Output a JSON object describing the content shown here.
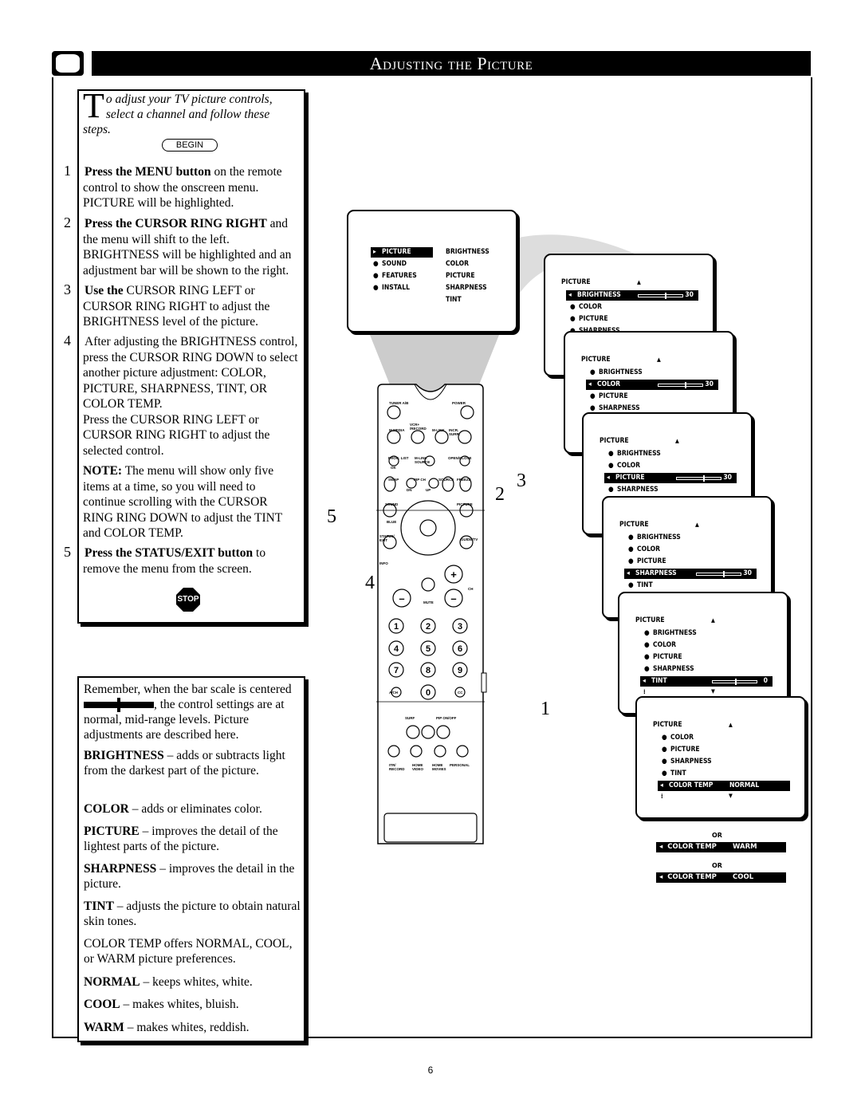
{
  "header": {
    "title": "Adjusting the Picture"
  },
  "intro": {
    "dropcap": "T",
    "text": "o adjust your TV picture controls, select a channel and follow these steps.",
    "begin": "BEGIN"
  },
  "steps": [
    {
      "num": "1",
      "bold": "Press the MENU button",
      "rest": " on the remote control to show the onscreen menu. PICTURE will be highlighted."
    },
    {
      "num": "2",
      "bold": "Press the CURSOR RING RIGHT",
      "rest": " and the menu will shift to the left. BRIGHTNESS will be highlighted and an adjustment bar will be shown to the right."
    },
    {
      "num": "3",
      "bold": "Use the",
      "rest": " CURSOR RING LEFT or CURSOR RING RIGHT to adjust the BRIGHTNESS level of the picture."
    },
    {
      "num": "4",
      "bold": "",
      "rest": "After adjusting the BRIGHTNESS control, press the CURSOR RING DOWN to select another picture adjustment: COLOR, PICTURE, SHARPNESS, TINT, OR COLOR TEMP.",
      "extra": "Press the CURSOR RING LEFT or CURSOR RING RIGHT to adjust the selected control.",
      "note_bold": "NOTE:",
      "note": " The menu will show only five items at a time, so you will need to continue scrolling with the CURSOR RING RING DOWN to adjust the TINT and COLOR TEMP."
    },
    {
      "num": "5",
      "bold": "Press the STATUS/EXIT button",
      "rest": " to remove the menu from the screen."
    }
  ],
  "stop": "STOP",
  "info": {
    "remember_a": "Remember, when the bar scale is centered",
    "remember_b": ", the control settings are at normal, mid-range levels. Picture adjustments are described here.",
    "items": [
      {
        "term": "BRIGHTNESS",
        "desc": " – adds or subtracts light from the darkest part of the picture."
      },
      {
        "term": "COLOR",
        "desc": " – adds or eliminates color."
      },
      {
        "term": "PICTURE",
        "desc": " – improves the detail of the lightest parts of the picture."
      },
      {
        "term": "SHARPNESS",
        "desc": " – improves the detail in the picture."
      },
      {
        "term": "TINT",
        "desc": " – adjusts the picture to obtain natural skin tones."
      },
      {
        "term": "",
        "desc": "COLOR TEMP offers NORMAL, COOL, or WARM picture preferences."
      },
      {
        "term": "NORMAL",
        "desc": " – keeps whites, white."
      },
      {
        "term": "COOL",
        "desc": " – makes whites, bluish."
      },
      {
        "term": "WARM",
        "desc": " – makes whites, reddish."
      }
    ]
  },
  "main_menu": {
    "left": [
      "PICTURE",
      "SOUND",
      "FEATURES",
      "INSTALL"
    ],
    "right": [
      "BRIGHTNESS",
      "COLOR",
      "PICTURE",
      "SHARPNESS",
      "TINT"
    ]
  },
  "menus": [
    {
      "title": "PICTURE",
      "items": [
        "BRIGHTNESS",
        "COLOR",
        "PICTURE",
        "SHARPNESS"
      ],
      "selected": 0,
      "value": "30",
      "level": 0.6
    },
    {
      "title": "PICTURE",
      "items": [
        "BRIGHTNESS",
        "COLOR",
        "PICTURE",
        "SHARPNESS"
      ],
      "selected": 1,
      "value": "30",
      "level": 0.6
    },
    {
      "title": "PICTURE",
      "items": [
        "BRIGHTNESS",
        "COLOR",
        "PICTURE",
        "SHARPNESS"
      ],
      "selected": 2,
      "value": "30",
      "level": 0.6
    },
    {
      "title": "PICTURE",
      "items": [
        "BRIGHTNESS",
        "COLOR",
        "PICTURE",
        "SHARPNESS",
        "TINT"
      ],
      "selected": 3,
      "value": "30",
      "level": 0.6
    },
    {
      "title": "PICTURE",
      "items": [
        "BRIGHTNESS",
        "COLOR",
        "PICTURE",
        "SHARPNESS",
        "TINT"
      ],
      "selected": 4,
      "value": "0",
      "level": 0.5
    },
    {
      "title": "PICTURE",
      "items": [
        "COLOR",
        "PICTURE",
        "SHARPNESS",
        "TINT",
        "COLOR TEMP"
      ],
      "selected": 4,
      "value": "NORMAL"
    }
  ],
  "alternatives": {
    "or": "OR",
    "rows": [
      {
        "label": "COLOR TEMP",
        "value": "WARM"
      },
      {
        "label": "COLOR TEMP",
        "value": "COOL"
      }
    ]
  },
  "callouts": [
    "5",
    "4",
    "2",
    "3",
    "1"
  ],
  "remote": {
    "labels": [
      "TUNER A/B",
      "POWER",
      "M.MEDIA",
      "VCR+ /RECORD",
      "M-LINK",
      "INCR. SURR.",
      "PROG. LIST",
      "M-LINK SOURCE",
      "OPEN/CLOSE",
      "OK",
      "SWAP",
      "PIP CH",
      "SOURCE",
      "FREEZE",
      "DN",
      "UP",
      "SOUND",
      "PICTURE",
      "BLUE",
      "STATUS/ EXIT",
      "GUIDE/TV",
      "INFO",
      "MUTE",
      "CH",
      "A/CH",
      "CC",
      "SURF",
      "PIP ON/OFF",
      "ITR/ RECORD",
      "HOME VIDEO",
      "HOME MOVIES",
      "PERSONAL"
    ],
    "digits": [
      "1",
      "2",
      "3",
      "4",
      "5",
      "6",
      "7",
      "8",
      "9",
      "0"
    ]
  },
  "page_number": "6"
}
